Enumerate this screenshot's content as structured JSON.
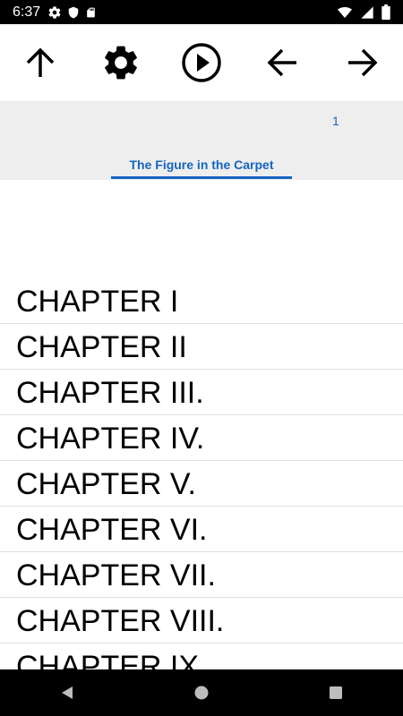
{
  "status_bar": {
    "time": "6:37",
    "left_icons": [
      "gear-icon",
      "shield-icon",
      "sd-card-icon"
    ],
    "right_icons": [
      "wifi-icon",
      "signal-icon",
      "battery-icon"
    ]
  },
  "toolbar": {
    "buttons": [
      "up-arrow-icon",
      "settings-icon",
      "play-icon",
      "back-arrow-icon",
      "forward-arrow-icon"
    ]
  },
  "header": {
    "page_number": "1",
    "tab_title": "The Figure in the Carpet",
    "accent_color": "#1565c0"
  },
  "chapters": [
    "CHAPTER I",
    "CHAPTER II",
    "CHAPTER III.",
    "CHAPTER IV.",
    "CHAPTER V.",
    "CHAPTER VI.",
    "CHAPTER VII.",
    "CHAPTER VIII.",
    "CHAPTER IX."
  ],
  "nav_bar": {
    "buttons": [
      "back-icon",
      "home-icon",
      "recents-icon"
    ]
  }
}
